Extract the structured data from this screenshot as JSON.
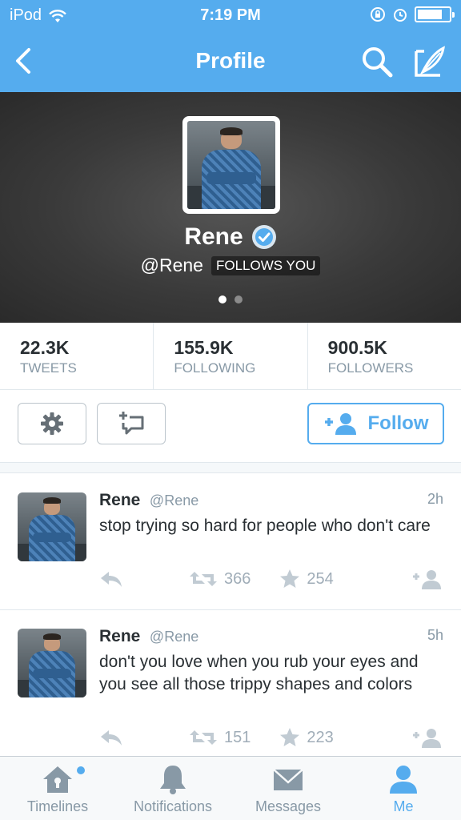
{
  "status_bar": {
    "carrier": "iPod",
    "time": "7:19 PM",
    "battery_fraction": 0.8
  },
  "nav": {
    "title": "Profile"
  },
  "profile": {
    "name": "Rene",
    "handle": "@Rene",
    "follows_you": "FOLLOWS YOU",
    "verified": true,
    "page_count": 2,
    "active_page": 1
  },
  "stats": [
    {
      "value": "22.3K",
      "label": "TWEETS"
    },
    {
      "value": "155.9K",
      "label": "FOLLOWING"
    },
    {
      "value": "900.5K",
      "label": "FOLLOWERS"
    }
  ],
  "actions": {
    "follow_label": "Follow"
  },
  "tweets": [
    {
      "name": "Rene",
      "handle": "@Rene",
      "time": "2h",
      "text": "stop trying so hard for people who don't care",
      "retweets": "366",
      "favorites": "254"
    },
    {
      "name": "Rene",
      "handle": "@Rene",
      "time": "5h",
      "text": "don't you love when you rub your eyes and you see all those trippy shapes and colors",
      "retweets": "151",
      "favorites": "223"
    }
  ],
  "tabbar": {
    "items": [
      {
        "label": "Timelines",
        "icon": "home-icon"
      },
      {
        "label": "Notifications",
        "icon": "bell-icon"
      },
      {
        "label": "Messages",
        "icon": "envelope-icon"
      },
      {
        "label": "Me",
        "icon": "person-icon"
      }
    ],
    "active": "Me"
  },
  "colors": {
    "brand": "#55acee",
    "muted": "#8899a6",
    "text": "#292f33"
  }
}
